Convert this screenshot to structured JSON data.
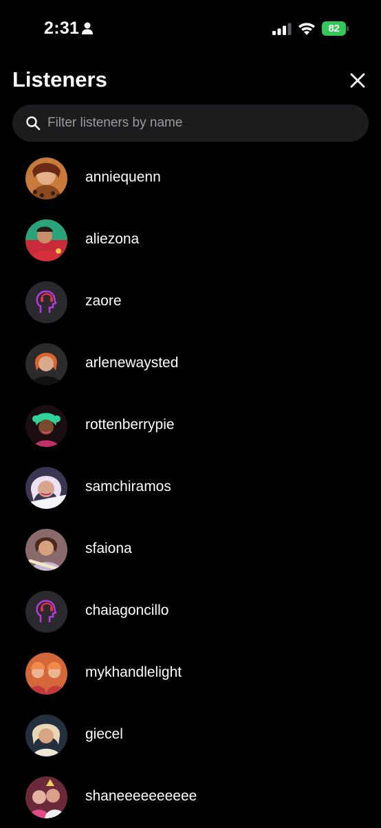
{
  "status_bar": {
    "time": "2:31",
    "battery_level": "82",
    "icons": [
      "person-icon",
      "signal-icon",
      "wifi-icon",
      "battery-icon"
    ],
    "battery_color": "#34c759"
  },
  "header": {
    "title": "Listeners",
    "close_icon": "close-icon"
  },
  "search": {
    "placeholder": "Filter listeners by name",
    "value": ""
  },
  "listeners": [
    {
      "username": "anniequenn",
      "avatar": "photo"
    },
    {
      "username": "aliezona",
      "avatar": "photo"
    },
    {
      "username": "zaore",
      "avatar": "default-headphones"
    },
    {
      "username": "arlenewaysted",
      "avatar": "photo"
    },
    {
      "username": "rottenberrypie",
      "avatar": "photo"
    },
    {
      "username": "samchiramos",
      "avatar": "photo"
    },
    {
      "username": "sfaiona",
      "avatar": "photo"
    },
    {
      "username": "chaiagoncillo",
      "avatar": "default-headphones"
    },
    {
      "username": "mykhandlelight",
      "avatar": "photo"
    },
    {
      "username": "giecel",
      "avatar": "photo"
    },
    {
      "username": "shaneeeeeeeeee",
      "avatar": "photo"
    }
  ],
  "colors": {
    "background": "#000000",
    "search_background": "#1c1c1f",
    "placeholder": "#9a9aa0",
    "default_avatar_accent": "#b13bd6"
  }
}
